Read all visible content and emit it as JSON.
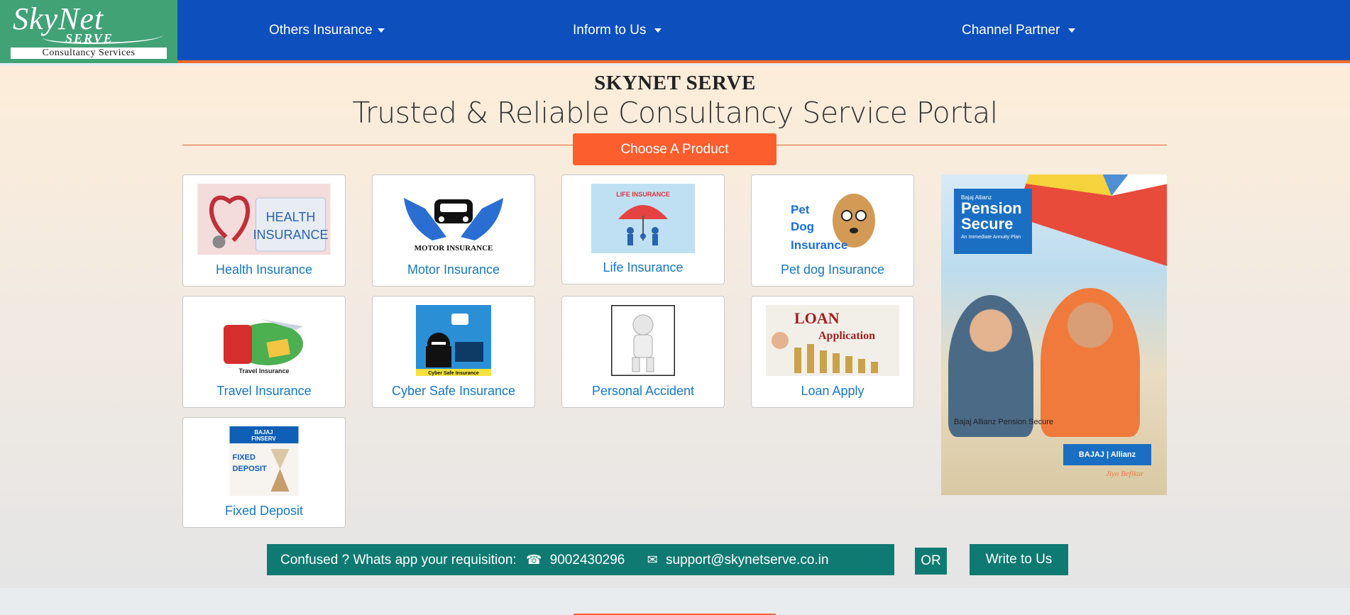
{
  "logo": {
    "line1": "SkyNet",
    "line2": "SERVE",
    "tagline": "Consultancy Services"
  },
  "nav": [
    {
      "label": "Others Insurance"
    },
    {
      "label": "Inform to Us"
    },
    {
      "label": "Channel Partner"
    }
  ],
  "hero": {
    "brand": "SKYNET SERVE",
    "subtitle": "Trusted & Reliable Consultancy Service Portal",
    "choose_label": "Choose A Product"
  },
  "products": [
    {
      "label": "Health Insurance",
      "icon": "health-insurance-image"
    },
    {
      "label": "Motor Insurance",
      "icon": "motor-insurance-image",
      "image_text": "MOTOR INSURANCE"
    },
    {
      "label": "Life Insurance",
      "icon": "life-insurance-image",
      "image_text": "LIFE INSURANCE"
    },
    {
      "label": "Pet dog Insurance",
      "icon": "pet-dog-insurance-image",
      "image_text": "Pet Dog Insurance"
    },
    {
      "label": "Travel Insurance",
      "icon": "travel-insurance-image",
      "image_text": "Travel Insurance"
    },
    {
      "label": "Cyber Safe Insurance",
      "icon": "cyber-safe-insurance-image",
      "image_text": "Cyber Safe Insurance"
    },
    {
      "label": "Personal Accident",
      "icon": "personal-accident-image"
    },
    {
      "label": "Loan Apply",
      "icon": "loan-apply-image",
      "image_text": "LOAN Application"
    },
    {
      "label": "Fixed Deposit",
      "icon": "fixed-deposit-image",
      "image_text": "BAJAJ FINSERV FIXED DEPOSIT"
    }
  ],
  "ad": {
    "brand_small": "Bajaj Allianz",
    "title": "Pension Secure",
    "tagline": "An Immediate Annuity Plan",
    "caption": "Bajaj Allianz Pension Secure",
    "logo_text": "BAJAJ | Allianz",
    "sign": "Jiyo Befikar"
  },
  "contact": {
    "prompt": "Confused ? Whats app your requisition:",
    "phone": "9002430296",
    "email": "support@skynetserve.co.in",
    "or": "OR",
    "write": "Write to Us"
  },
  "colors": {
    "nav_bg": "#0c4fbd",
    "logo_bg": "#41a276",
    "accent_orange": "#fc5e2e",
    "teal": "#0f7a72",
    "link_blue": "#1778c2"
  }
}
